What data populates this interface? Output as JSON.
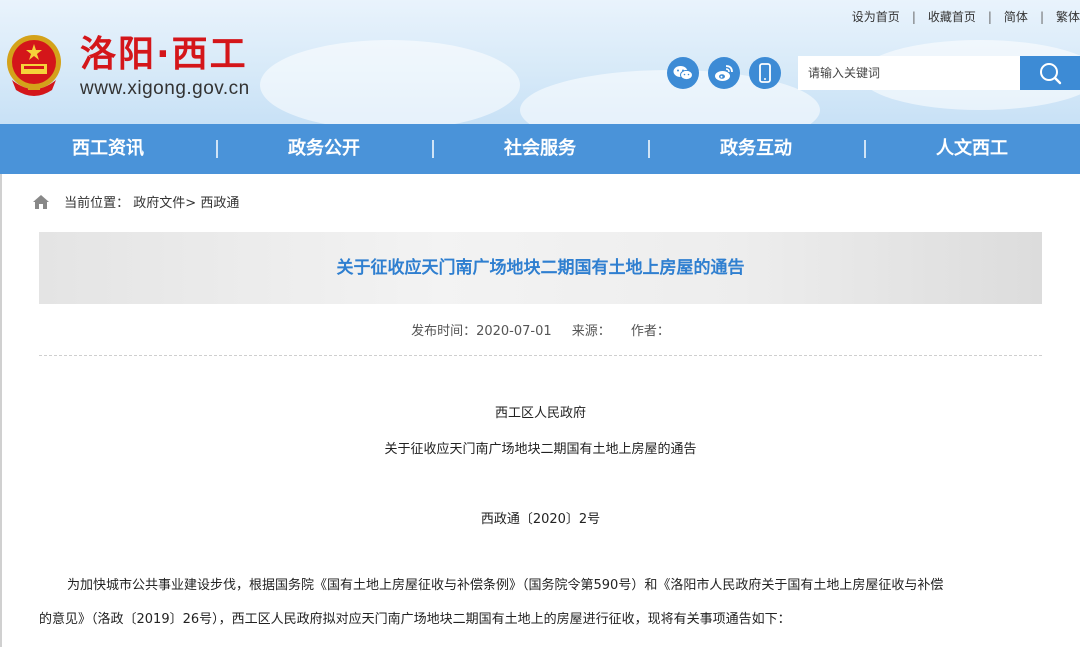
{
  "header": {
    "site_title": "洛阳·西工",
    "site_url": "www.xigong.gov.cn",
    "top_links": [
      "设为首页",
      "收藏首页",
      "简体",
      "繁体"
    ],
    "search_placeholder": "请输入关键词",
    "social_icons": [
      "wechat-icon",
      "weibo-icon",
      "mobile-icon"
    ],
    "brand_color": "#d4161a",
    "accent_color": "#4a93d9"
  },
  "nav": {
    "items": [
      "西工资讯",
      "政务公开",
      "社会服务",
      "政务互动",
      "人文西工"
    ]
  },
  "breadcrumb": {
    "label": "当前位置：",
    "path": [
      "政府文件>",
      "西政通"
    ]
  },
  "article": {
    "title": "关于征收应天门南广场地块二期国有土地上房屋的通告",
    "publish_label": "发布时间：2020-07-01",
    "source_label": "来源：",
    "author_label": "作者：",
    "issuer": "西工区人民政府",
    "subtitle": "关于征收应天门南广场地块二期国有土地上房屋的通告",
    "doc_number": "西政通〔2020〕2号",
    "body_line1": "为加快城市公共事业建设步伐，根据国务院《国有土地上房屋征收与补偿条例》（国务院令第590号）和《洛阳市人民政府关于国有土地上房屋征收与补偿",
    "body_line2": "的意见》（洛政〔2019〕26号），西工区人民政府拟对应天门南广场地块二期国有土地上的房屋进行征收，现将有关事项通告如下："
  }
}
